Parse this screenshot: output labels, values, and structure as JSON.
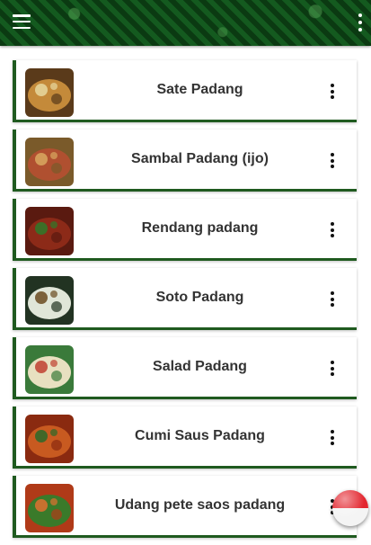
{
  "appbar": {
    "menu_icon": "hamburger-menu-icon",
    "overflow_icon": "vertical-dots-icon"
  },
  "recipes": [
    {
      "title": "Sate Padang",
      "thumb_colors": [
        "#5a3a1a",
        "#c48a3a",
        "#e8d8a0"
      ]
    },
    {
      "title": "Sambal Padang (ijo)",
      "thumb_colors": [
        "#7a5a2a",
        "#b05030",
        "#d9a860"
      ]
    },
    {
      "title": "Rendang padang",
      "thumb_colors": [
        "#5a1a10",
        "#8c2a18",
        "#2e7a2a"
      ]
    },
    {
      "title": "Soto Padang",
      "thumb_colors": [
        "#223322",
        "#e0e6d8",
        "#6a4a20"
      ]
    },
    {
      "title": "Salad Padang",
      "thumb_colors": [
        "#3a7a3a",
        "#e8e0c0",
        "#c04030"
      ]
    },
    {
      "title": "Cumi Saus Padang",
      "thumb_colors": [
        "#8a2a10",
        "#c85a20",
        "#2a6a2a"
      ]
    },
    {
      "title": "Udang pete saos padang",
      "thumb_colors": [
        "#b03a18",
        "#3a7a2a",
        "#e07030"
      ]
    }
  ],
  "fab": {
    "icon": "indonesia-flag-icon",
    "colors": {
      "top": "#e3262f",
      "bottom": "#f4f4f4"
    }
  }
}
